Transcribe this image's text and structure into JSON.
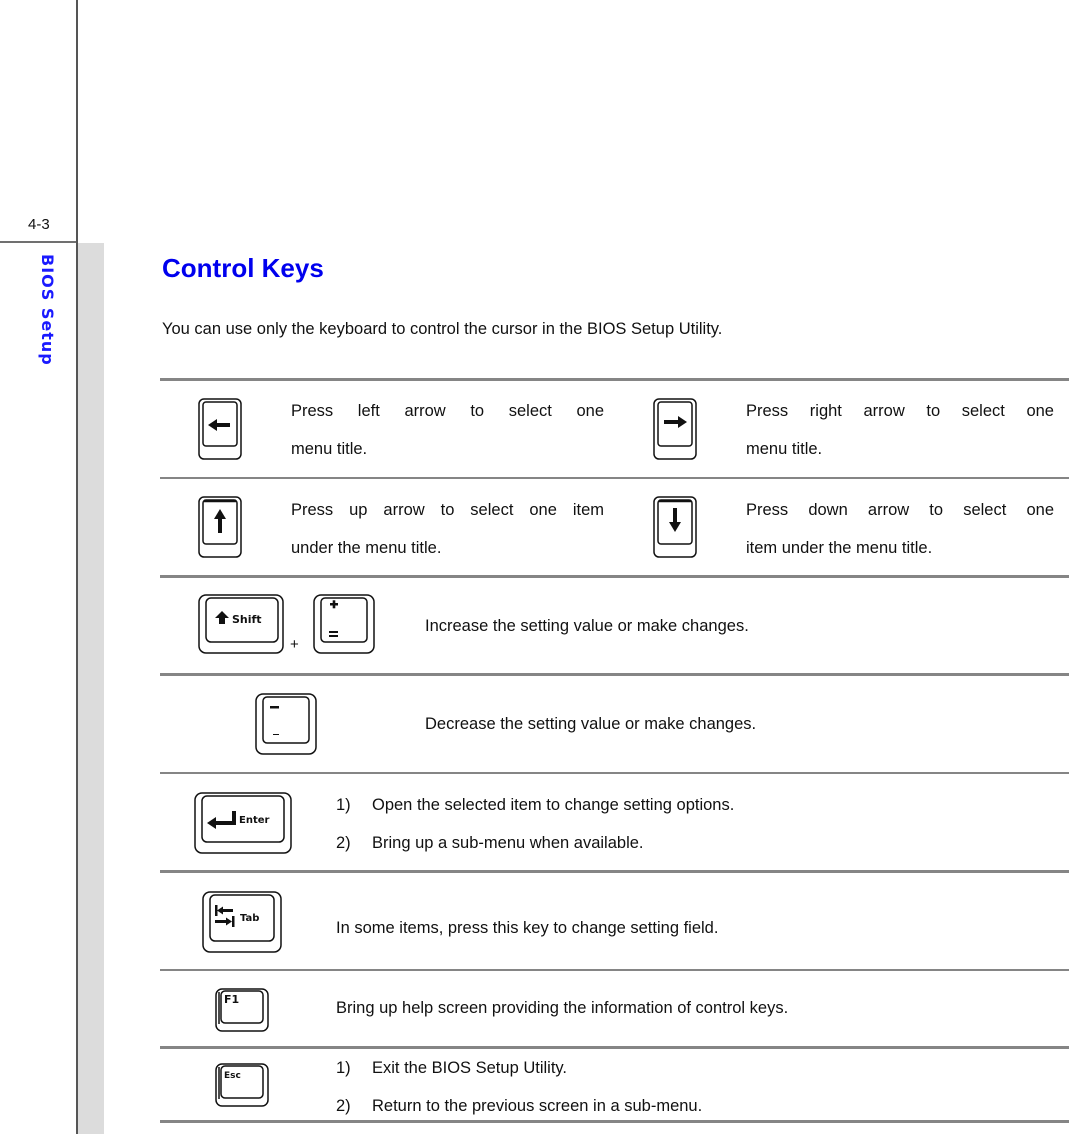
{
  "sidebar": {
    "page_number": "4-3",
    "section_title": "BIOS Setup"
  },
  "page": {
    "title": "Control Keys",
    "intro": "You can use only the keyboard to control the cursor in the BIOS Setup Utility.",
    "accent_color": "#0000ee"
  },
  "keys": {
    "left_arrow": {
      "icon": "left-arrow-key-icon",
      "desc_line1": "Press left arrow to select one",
      "desc_line2": "menu title."
    },
    "right_arrow": {
      "icon": "right-arrow-key-icon",
      "desc_line1": "Press right arrow to select one",
      "desc_line2": "menu title."
    },
    "up_arrow": {
      "icon": "up-arrow-key-icon",
      "desc_line1": "Press up arrow to select one item",
      "desc_line2": "under the menu title."
    },
    "down_arrow": {
      "icon": "down-arrow-key-icon",
      "desc_line1": "Press down arrow to select one",
      "desc_line2": "item under the menu title."
    },
    "shift_plus": {
      "icon": "shift-plus-key-icon",
      "shift_label": "Shift",
      "plus_sign": "+",
      "desc": "Increase the setting value or make changes."
    },
    "minus": {
      "icon": "minus-key-icon",
      "desc": "Decrease the setting value or make changes."
    },
    "enter": {
      "icon": "enter-key-icon",
      "label": "Enter",
      "items": [
        {
          "num": "1)",
          "text": "Open the selected item to change setting options."
        },
        {
          "num": "2)",
          "text": "Bring up a sub-menu when available."
        }
      ]
    },
    "tab": {
      "icon": "tab-key-icon",
      "label": "Tab",
      "desc": "In some items, press this key to change setting field."
    },
    "f1": {
      "icon": "f1-key-icon",
      "label": "F1",
      "desc": "Bring up help screen providing the information of control keys."
    },
    "esc": {
      "icon": "esc-key-icon",
      "label": "Esc",
      "items": [
        {
          "num": "1)",
          "text": "Exit the BIOS Setup Utility."
        },
        {
          "num": "2)",
          "text": "Return to the previous screen in a sub-menu."
        }
      ]
    }
  }
}
